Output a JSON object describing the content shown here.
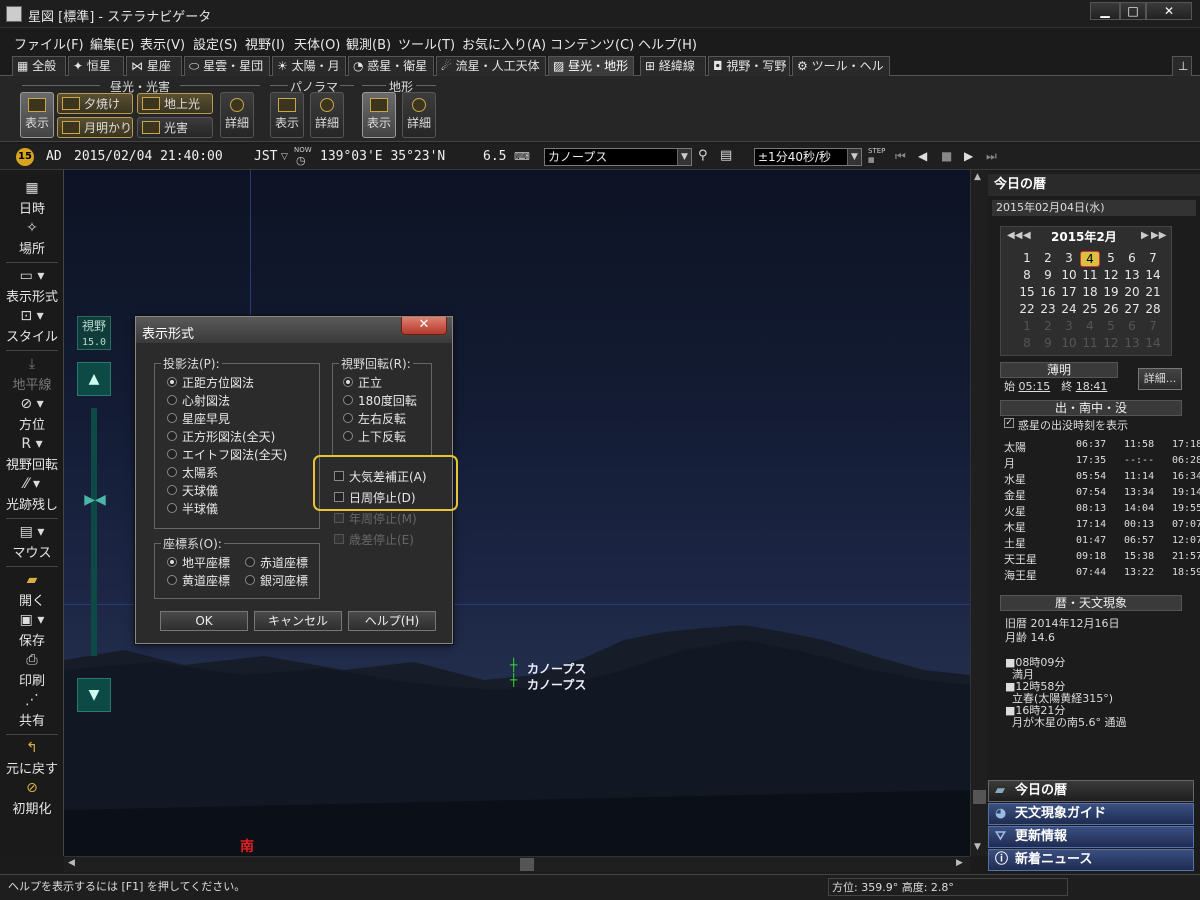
{
  "window": {
    "title": "星図 [標準] - ステラナビゲータ",
    "minimize": "▁",
    "maximize": "□",
    "close": "✕"
  },
  "menu": [
    "ファイル(F)",
    "編集(E)",
    "表示(V)",
    "設定(S)",
    "視野(I)",
    "天体(O)",
    "観測(B)",
    "ツール(T)",
    "お気に入り(A)",
    "コンテンツ(C)",
    "ヘルプ(H)"
  ],
  "tabs": [
    "全般",
    "恒星",
    "星座",
    "星雲・星団",
    "太陽・月",
    "惑星・衛星",
    "流星・人工天体",
    "昼光・地形",
    "経緯線",
    "視野・写野",
    "ツール・ヘルプ"
  ],
  "tab_icons": [
    "grid-icon",
    "star-icon",
    "constellation-icon",
    "nebula-icon",
    "sun-icon",
    "planet-icon",
    "meteor-icon",
    "landscape-icon",
    "gridlines-icon",
    "camera-icon",
    "gear-icon"
  ],
  "ribbon": {
    "group_daylight": "昼光・光害",
    "group_panorama": "パノラマ",
    "group_terrain": "地形",
    "show": "表示",
    "detail": "詳細",
    "sunset": "夕焼け",
    "earthshine": "地上光",
    "twilight": "月明かり",
    "light_pollution": "光害"
  },
  "toolbar": {
    "era": "AD",
    "datetime": "2015/02/04 21:40:00",
    "tz": "JST",
    "now": "NOW",
    "coords": "139°03'E 35°23'N",
    "mag": "6.5",
    "target": "カノープス",
    "step": "±1分40秒/秒"
  },
  "leftbar": [
    "日時",
    "場所",
    "表示形式",
    "スタイル",
    "地平線",
    "方位",
    "視野回転",
    "光跡残し",
    "マウス",
    "開く",
    "保存",
    "印刷",
    "共有",
    "元に戻す",
    "初期化"
  ],
  "leftbar_icons": [
    "calendar-icon",
    "location-icon",
    "display-format-icon",
    "style-icon",
    "horizon-icon",
    "compass-icon",
    "rotate-icon",
    "trail-icon",
    "mouse-icon",
    "open-icon",
    "save-icon",
    "print-icon",
    "share-icon",
    "undo-icon",
    "reset-icon"
  ],
  "sky": {
    "fov_label": "視野",
    "fov_value": "15.0",
    "star_name": "カノープス",
    "direction": "南"
  },
  "dialog": {
    "title": "表示形式",
    "projection_label": "投影法(P):",
    "projections": [
      "正距方位図法",
      "心射図法",
      "星座早見",
      "正方形図法(全天)",
      "エイトフ図法(全天)",
      "太陽系",
      "天球儀",
      "半球儀"
    ],
    "rotation_label": "視野回転(R):",
    "rotations": [
      "正立",
      "180度回転",
      "左右反転",
      "上下反転"
    ],
    "coord_label": "座標系(O):",
    "coords": [
      "地平座標",
      "赤道座標",
      "黄道座標",
      "銀河座標"
    ],
    "checks": [
      "大気差補正(A)",
      "日周停止(D)",
      "年周停止(M)",
      "歳差停止(E)"
    ],
    "ok": "OK",
    "cancel": "キャンセル",
    "help": "ヘルプ(H)"
  },
  "panel": {
    "title": "今日の暦",
    "date": "2015年02月04日(水)",
    "month": "2015年2月",
    "days": [
      [
        "1",
        "2",
        "3",
        "4",
        "5",
        "6",
        "7"
      ],
      [
        "8",
        "9",
        "10",
        "11",
        "12",
        "13",
        "14"
      ],
      [
        "15",
        "16",
        "17",
        "18",
        "19",
        "20",
        "21"
      ],
      [
        "22",
        "23",
        "24",
        "25",
        "26",
        "27",
        "28"
      ],
      [
        "1",
        "2",
        "3",
        "4",
        "5",
        "6",
        "7"
      ],
      [
        "8",
        "9",
        "10",
        "11",
        "12",
        "13",
        "14"
      ]
    ],
    "twilight_title": "薄明",
    "tw_start_label": "始",
    "tw_start": "05:15",
    "tw_end_label": "終",
    "tw_end": "18:41",
    "detail": "詳細...",
    "rise_title": "出・南中・没",
    "rise_check": "惑星の出没時刻を表示",
    "bodies": [
      [
        "太陽",
        "06:37",
        "11:58",
        "17:18"
      ],
      [
        "月",
        "17:35",
        "--:--",
        "06:28"
      ],
      [
        "水星",
        "05:54",
        "11:14",
        "16:34"
      ],
      [
        "金星",
        "07:54",
        "13:34",
        "19:14"
      ],
      [
        "火星",
        "08:13",
        "14:04",
        "19:55"
      ],
      [
        "木星",
        "17:14",
        "00:13",
        "07:07"
      ],
      [
        "土星",
        "01:47",
        "06:57",
        "12:07"
      ],
      [
        "天王星",
        "09:18",
        "15:38",
        "21:57"
      ],
      [
        "海王星",
        "07:44",
        "13:22",
        "18:59"
      ]
    ],
    "calendar_title": "暦・天文現象",
    "old_calendar": "旧暦 2014年12月16日",
    "moon_age": "月齢 14.6",
    "events": [
      [
        "08時09分",
        "満月"
      ],
      [
        "12時58分",
        "立春(太陽黄経315°)"
      ],
      [
        "16時21分",
        "月が木星の南5.6° 通過"
      ]
    ]
  },
  "dock": [
    "今日の暦",
    "天文現象ガイド",
    "更新情報",
    "新着ニュース"
  ],
  "status": {
    "help": "ヘルプを表示するには [F1] を押してください。",
    "position": "方位: 359.9° 高度:   2.8°"
  }
}
